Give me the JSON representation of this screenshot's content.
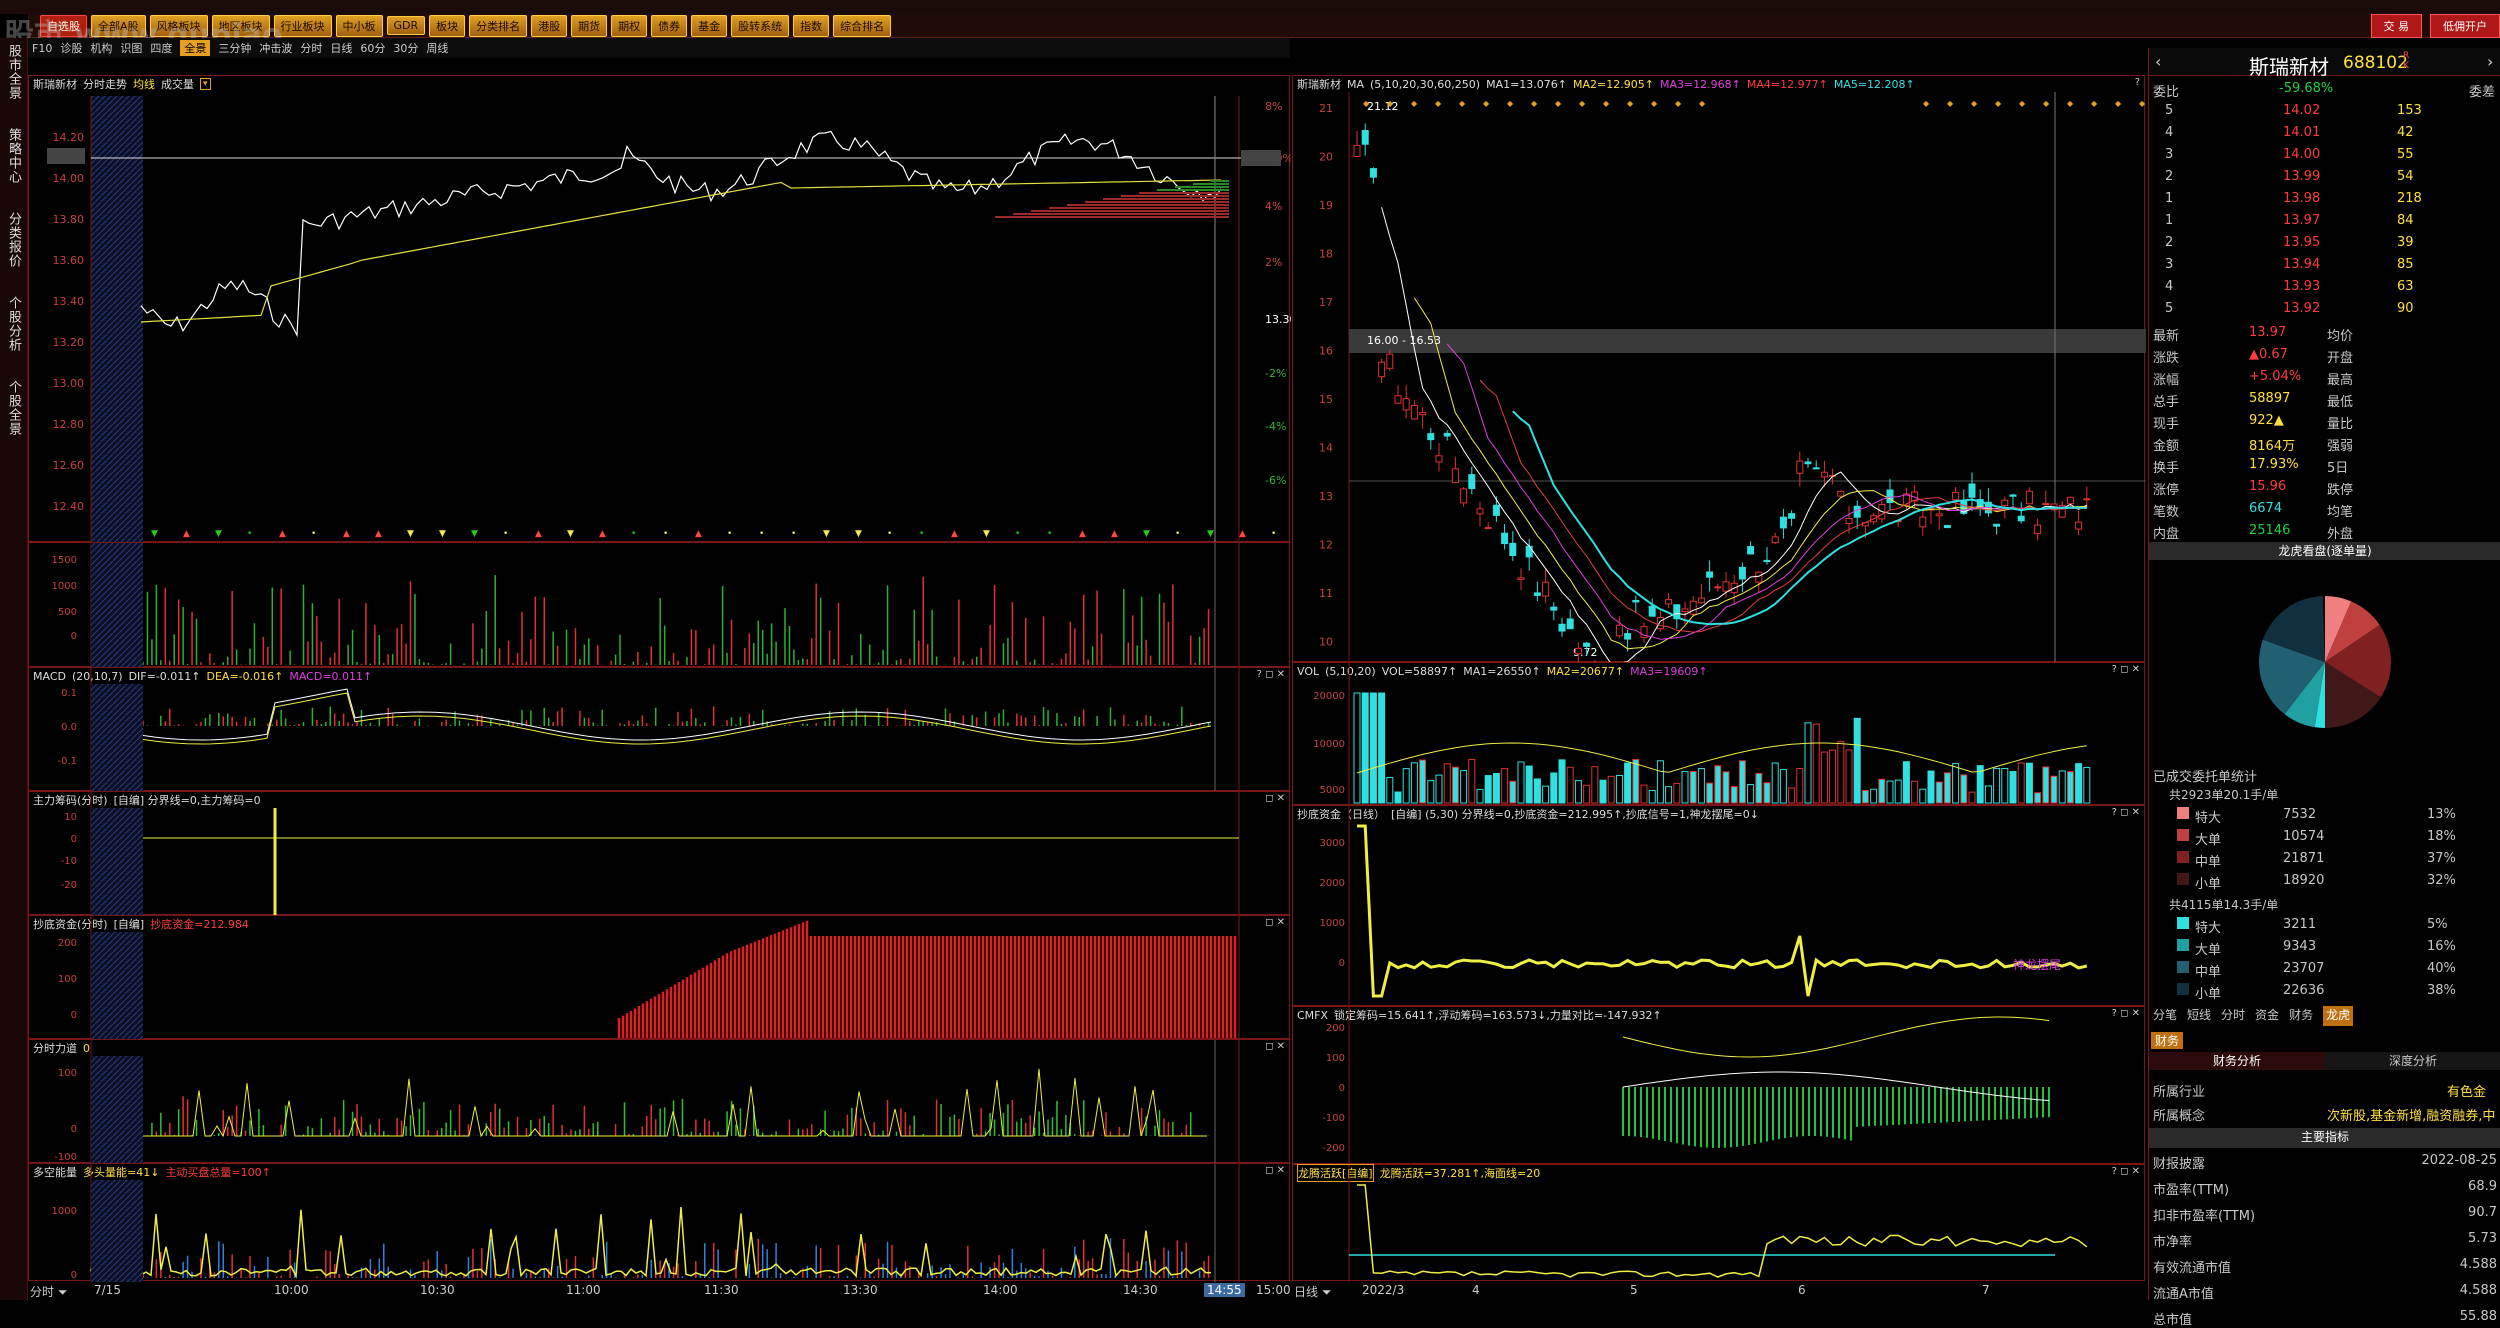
{
  "menu": [
    "自选股",
    "全部A股",
    "风格板块",
    "地区板块",
    "行业板块",
    "中小板",
    "GDR",
    "板块",
    "分类排名",
    "港股",
    "期货",
    "期权",
    "债券",
    "基金",
    "股转系统",
    "指数",
    "综合排名"
  ],
  "top_buttons": {
    "trade": "交 易",
    "margin": "低佣开户"
  },
  "watermark": "股市 www.gupiao",
  "left_tabs": [
    "股市全景",
    "策略中心",
    "分类报价",
    "个股分析",
    "个股全景"
  ],
  "toolbar": [
    "F10",
    "诊股",
    "机构",
    "识图",
    "四度",
    "全景",
    "三分钟",
    "冲击波",
    "分时",
    "日线",
    "60分",
    "30分",
    "周线"
  ],
  "toolbar_selected": "全景",
  "intraday": {
    "title": "斯瑞新材",
    "subtitle": "分时走势",
    "legend1": "均线",
    "legend2": "成交量",
    "price_ticks": [
      "14.20",
      "14.10",
      "14.00",
      "13.80",
      "13.60",
      "13.40",
      "13.20",
      "13.00",
      "12.80",
      "12.60",
      "12.40"
    ],
    "pct_ticks": [
      "8%",
      "6.0%",
      "4%",
      "2%",
      "13.30",
      "-2%",
      "-4%",
      "-6%"
    ],
    "vol_ticks": [
      "1500",
      "1000",
      "500",
      "0",
      "1500",
      "1000",
      "500"
    ],
    "macd_title": "MACD",
    "macd_params": "(20,10,7)",
    "macd_dif": "DIF=-0.011↑",
    "macd_dea": "DEA=-0.016↑",
    "macd_val": "MACD=0.011↑",
    "macd_ticks": [
      "0.1",
      "0.0",
      "-0.1"
    ],
    "zlcm_title": "主力筹码(分时)",
    "zlcm_info": "[自编]  分界线=0,主力筹码=0",
    "zlcm_ticks": [
      "10",
      "0",
      "-10",
      "-20"
    ],
    "cdzj_title": "抄底资金(分时)",
    "cdzj_info": "[自编]",
    "cdzj_val": "抄底资金=212.984",
    "cdzj_ticks": [
      "200",
      "100",
      "0"
    ],
    "fsld_title": "分时力道",
    "fsld_val": "0",
    "fsld_ticks": [
      "100",
      "0",
      "-100"
    ],
    "dkn_title": "多空能量",
    "dkn_long": "多头量能=41↓",
    "dkn_short": "主动买盘总量=100↑",
    "dkn_ticks": [
      "1000",
      "0"
    ],
    "times": [
      "7/15",
      "10:00",
      "10:30",
      "11:00",
      "11:30",
      "13:30",
      "14:00",
      "14:30",
      "14:55",
      "15:00"
    ],
    "time_label": "分时"
  },
  "daily": {
    "title": "斯瑞新材",
    "ma_label": "MA",
    "ma_params": "(5,10,20,30,60,250)",
    "ma1": "MA1=13.076↑",
    "ma2": "MA2=12.905↑",
    "ma3": "MA3=12.968↑",
    "ma4": "MA4=12.977↑",
    "ma5": "MA5=12.208↑",
    "price_ticks": [
      "21",
      "20",
      "19",
      "18",
      "17",
      "16",
      "15",
      "14",
      "13",
      "12",
      "11",
      "10"
    ],
    "high_label": "21.12",
    "low_label": "9.72",
    "band_label": "16.00 - 16.53",
    "vol_title": "VOL",
    "vol_params": "(5,10,20)",
    "vol_val": "VOL=58897↑",
    "vol_ma1": "MA1=26550↑",
    "vol_ma2": "MA2=20677↑",
    "vol_ma3": "MA3=19609↑",
    "vol_ticks": [
      "20000",
      "10000",
      "5000"
    ],
    "cdzj_title": "抄底资金（日线）",
    "cdzj_info": "[自编]  (5,30)  分界线=0,抄底资金=212.995↑,抄底信号=1,神龙摆尾=0↓",
    "cdzj_ticks": [
      "3000",
      "2000",
      "1000",
      "0"
    ],
    "cdzj_tag": "神龙摆尾",
    "cmfx_title": "CMFX",
    "cmfx_info": "锁定筹码=15.641↑,浮动筹码=163.573↓,力量对比=-147.932↑",
    "cmfx_ticks": [
      "200",
      "100",
      "0",
      "-100",
      "-200"
    ],
    "lthy_title": "龙腾活跃[自编]",
    "lthy_info": "龙腾活跃=37.281↑,海面线=20",
    "dates": [
      "2022/3",
      "4",
      "5",
      "6",
      "7"
    ],
    "date_label": "日线"
  },
  "quote": {
    "name": "斯瑞新材",
    "code": "688102",
    "webi_label": "委比",
    "webi": "-59.68%",
    "webi_right": "委差",
    "asks": [
      {
        "lvl": "5",
        "price": "14.02",
        "vol": "153"
      },
      {
        "lvl": "4",
        "price": "14.01",
        "vol": "42"
      },
      {
        "lvl": "3",
        "price": "14.00",
        "vol": "55"
      },
      {
        "lvl": "2",
        "price": "13.99",
        "vol": "54"
      },
      {
        "lvl": "1",
        "price": "13.98",
        "vol": "218"
      }
    ],
    "bids": [
      {
        "lvl": "1",
        "price": "13.97",
        "vol": "84"
      },
      {
        "lvl": "2",
        "price": "13.95",
        "vol": "39"
      },
      {
        "lvl": "3",
        "price": "13.94",
        "vol": "85"
      },
      {
        "lvl": "4",
        "price": "13.93",
        "vol": "63"
      },
      {
        "lvl": "5",
        "price": "13.92",
        "vol": "90"
      }
    ],
    "stats": [
      {
        "k": "最新",
        "v": "13.97",
        "k2": "均价",
        "c": "red"
      },
      {
        "k": "涨跌",
        "v": "▲0.67",
        "k2": "开盘",
        "c": "red"
      },
      {
        "k": "涨幅",
        "v": "+5.04%",
        "k2": "最高",
        "c": "red"
      },
      {
        "k": "总手",
        "v": "58897",
        "k2": "最低",
        "c": "yellow"
      },
      {
        "k": "现手",
        "v": "922▲",
        "k2": "量比",
        "c": "yellow"
      },
      {
        "k": "金额",
        "v": "8164万",
        "k2": "强弱",
        "c": "yellow"
      },
      {
        "k": "换手",
        "v": "17.93%",
        "k2": "5日",
        "c": "yellow"
      },
      {
        "k": "涨停",
        "v": "15.96",
        "k2": "跌停",
        "c": "red"
      },
      {
        "k": "笔数",
        "v": "6674",
        "k2": "均笔",
        "c": "cyan"
      },
      {
        "k": "内盘",
        "v": "25146",
        "k2": "外盘",
        "c": "green"
      }
    ],
    "pie_title": "龙虎看盘(逐单量)",
    "deal_title": "已成交委托单统计",
    "buy_summary": "共2923单20.1手/单",
    "buy_rows": [
      {
        "k": "特大",
        "v": "7532",
        "p": "13%"
      },
      {
        "k": "大单",
        "v": "10574",
        "p": "18%"
      },
      {
        "k": "中单",
        "v": "21871",
        "p": "37%"
      },
      {
        "k": "小单",
        "v": "18920",
        "p": "32%"
      }
    ],
    "sell_summary": "共4115单14.3手/单",
    "sell_rows": [
      {
        "k": "特大",
        "v": "3211",
        "p": "5%"
      },
      {
        "k": "大单",
        "v": "9343",
        "p": "16%"
      },
      {
        "k": "中单",
        "v": "23707",
        "p": "40%"
      },
      {
        "k": "小单",
        "v": "22636",
        "p": "38%"
      }
    ],
    "tabs": [
      "分笔",
      "短线",
      "分时",
      "资金",
      "财务",
      "龙虎"
    ],
    "fin_tab": "财务",
    "fin_sub1": "财务分析",
    "fin_sub2": "深度分析",
    "industry_k": "所属行业",
    "industry_v": "有色金",
    "concept_k": "所属概念",
    "concept_v": "次新股,基金新增,融资融券,中",
    "main_idx": "主要指标",
    "fin_rows": [
      {
        "k": "财报披露",
        "v": "2022-08-25"
      },
      {
        "k": "市盈率(TTM)",
        "v": "68.9"
      },
      {
        "k": "扣非市盈率(TTM)",
        "v": "90.7"
      },
      {
        "k": "市净率",
        "v": "5.73"
      },
      {
        "k": "有效流通市值",
        "v": "4.588"
      },
      {
        "k": "流通A市值",
        "v": "4.588"
      },
      {
        "k": "总市值",
        "v": "55.88"
      }
    ]
  }
}
